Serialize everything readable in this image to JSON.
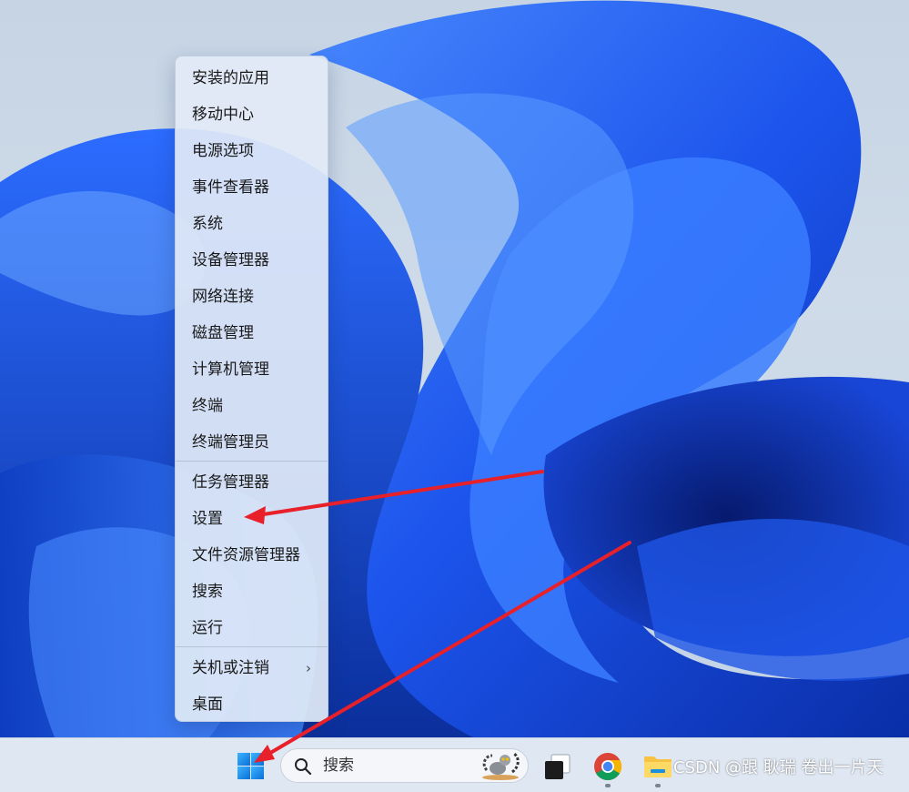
{
  "context_menu": {
    "items": [
      {
        "label": "安装的应用"
      },
      {
        "label": "移动中心"
      },
      {
        "label": "电源选项"
      },
      {
        "label": "事件查看器"
      },
      {
        "label": "系统"
      },
      {
        "label": "设备管理器"
      },
      {
        "label": "网络连接"
      },
      {
        "label": "磁盘管理"
      },
      {
        "label": "计算机管理"
      },
      {
        "label": "终端"
      },
      {
        "label": "终端管理员"
      },
      {
        "label": "任务管理器"
      },
      {
        "label": "设置"
      },
      {
        "label": "文件资源管理器"
      },
      {
        "label": "搜索"
      },
      {
        "label": "运行"
      },
      {
        "label": "关机或注销",
        "submenu_indicator": "›"
      },
      {
        "label": "桌面"
      }
    ]
  },
  "taskbar": {
    "search_label": "搜索",
    "icons": [
      "windows-start-icon",
      "search-icon",
      "task-view-icon",
      "chrome-icon",
      "file-explorer-icon"
    ]
  },
  "watermark": "CSDN @跟 耿瑞 卷出一片天",
  "colors": {
    "annotation_arrow": "#e8202a",
    "wallpaper_blue": "#1e5cf0",
    "windows_logo": "#1e90e8"
  }
}
